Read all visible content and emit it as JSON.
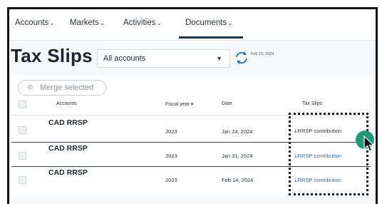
{
  "nav": {
    "items": [
      {
        "label": "Accounts",
        "chev": "⌄"
      },
      {
        "label": "Markets",
        "chev": "⌄"
      },
      {
        "label": "Activities",
        "chev": "⌄"
      },
      {
        "label": "Documents",
        "chev": "⌄"
      }
    ],
    "active": "Documents"
  },
  "page": {
    "title": "Tax Slips",
    "account_select": "All accounts",
    "date_stamp": "Feb 15, 2024"
  },
  "toolbar": {
    "merge_label": "Merge selected"
  },
  "table": {
    "headers": {
      "accounts": "Accounts",
      "fiscal_year": "Fiscal year ▾",
      "date": "Date",
      "tax_slips": "Tax Slips"
    },
    "rows": [
      {
        "account": "CAD RRSP",
        "fiscal_year": "2023",
        "date": "Jan 24, 2024",
        "slip": "RRSP contribution"
      },
      {
        "account": "CAD RRSP",
        "fiscal_year": "2023",
        "date": "Jan 31, 2024",
        "slip": "RRSP contribution"
      },
      {
        "account": "CAD RRSP",
        "fiscal_year": "2023",
        "date": "Feb 14, 2024",
        "slip": "RRSP contribution"
      }
    ]
  },
  "icons": {
    "refresh": "refresh-icon",
    "download": "download-icon",
    "merge": "merge-icon",
    "cursor": "mouse-pointer-icon"
  },
  "colors": {
    "accent": "#1f6fb3",
    "highlight": "#1e9a78",
    "nav_active": "#1a3550"
  }
}
